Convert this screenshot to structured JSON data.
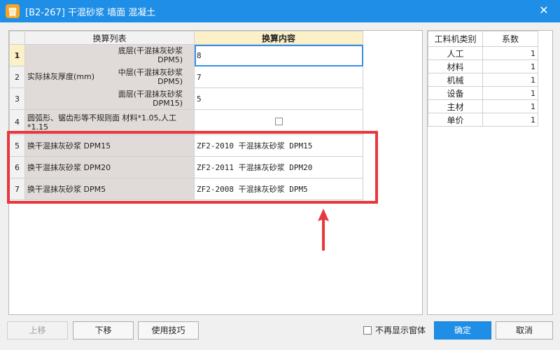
{
  "window": {
    "title": "[B2-267] 干混砂浆 墙面 混凝土",
    "logo_glyph": "冒",
    "close_glyph": "✕"
  },
  "table": {
    "col_list": "换算列表",
    "col_content": "换算内容",
    "group_label": "实际抹灰厚度(mm)",
    "rows": [
      {
        "num": "1",
        "label": "底层(干混抹灰砂浆 DPM5)",
        "value": "8"
      },
      {
        "num": "2",
        "label": "中层(干混抹灰砂浆 DPM5)",
        "value": "7"
      },
      {
        "num": "3",
        "label": "面层(干混抹灰砂浆 DPM15)",
        "value": "5"
      },
      {
        "num": "4",
        "label": "圆弧形、锯齿形等不规则面 材料*1.05,人工*1.15",
        "value": ""
      },
      {
        "num": "5",
        "label": "换干混抹灰砂浆 DPM15",
        "value": "ZF2-2010  干混抹灰砂浆 DPM15"
      },
      {
        "num": "6",
        "label": "换干混抹灰砂浆 DPM20",
        "value": "ZF2-2011  干混抹灰砂浆 DPM20"
      },
      {
        "num": "7",
        "label": "换干混抹灰砂浆 DPM5",
        "value": "ZF2-2008  干混抹灰砂浆 DPM5"
      }
    ]
  },
  "coef": {
    "col_type": "工料机类别",
    "col_factor": "系数",
    "rows": [
      {
        "type": "人工",
        "factor": "1"
      },
      {
        "type": "材料",
        "factor": "1"
      },
      {
        "type": "机械",
        "factor": "1"
      },
      {
        "type": "设备",
        "factor": "1"
      },
      {
        "type": "主材",
        "factor": "1"
      },
      {
        "type": "单价",
        "factor": "1"
      }
    ]
  },
  "buttons": {
    "move_up": "上移",
    "move_down": "下移",
    "tips": "使用技巧",
    "no_show": "不再显示窗体",
    "ok": "确定",
    "cancel": "取消"
  },
  "colors": {
    "titlebar": "#1e8ee6",
    "highlight_red": "#e8383d",
    "header_yellow": "#fbf0c8"
  }
}
